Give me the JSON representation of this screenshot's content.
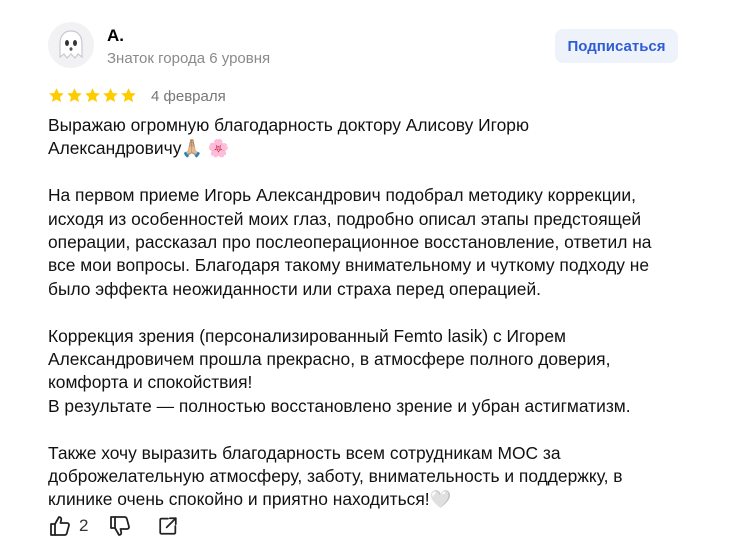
{
  "author": {
    "name": "А.",
    "level": "Знаток города 6 уровня",
    "avatar_icon": "ghost-avatar-icon"
  },
  "subscribe_label": "Подписаться",
  "rating": {
    "value": 5,
    "max": 5,
    "color": "#ffcc00"
  },
  "date": "4 февраля",
  "paragraphs": [
    "Выражаю огромную благодарность доктору Алисову Игорю\nАлександровичу🙏🏼 🌸",
    "На первом приеме Игорь Александрович подобрал методику коррекции,\nисходя из особенностей моих глаз, подробно описал этапы предстоящей\nоперации, рассказал про послеоперационное восстановление, ответил на\nвсе мои вопросы. Благодаря такому внимательному и чуткому подходу не\nбыло эффекта неожиданности или страха перед операцией.",
    "Коррекция зрения (персонализированный Femto lasik) с Игорем\nАлександровичем прошла прекрасно, в атмосфере полного доверия,\nкомфорта и спокойствия!\nВ результате — полностью восстановлено зрение и убран астигматизм.",
    "Также хочу выразить благодарность всем сотрудникам МОС за\nдоброжелательную атмосферу, заботу, внимательность и поддержку, в\nклинике очень спокойно и приятно находиться!🤍"
  ],
  "actions": {
    "like_count": "2",
    "like_icon": "thumbs-up-icon",
    "dislike_icon": "thumbs-down-icon",
    "share_icon": "share-icon"
  },
  "colors": {
    "accent": "#2f5cd6",
    "button_bg": "#eef3fb",
    "muted_text": "#8a8a8a"
  }
}
